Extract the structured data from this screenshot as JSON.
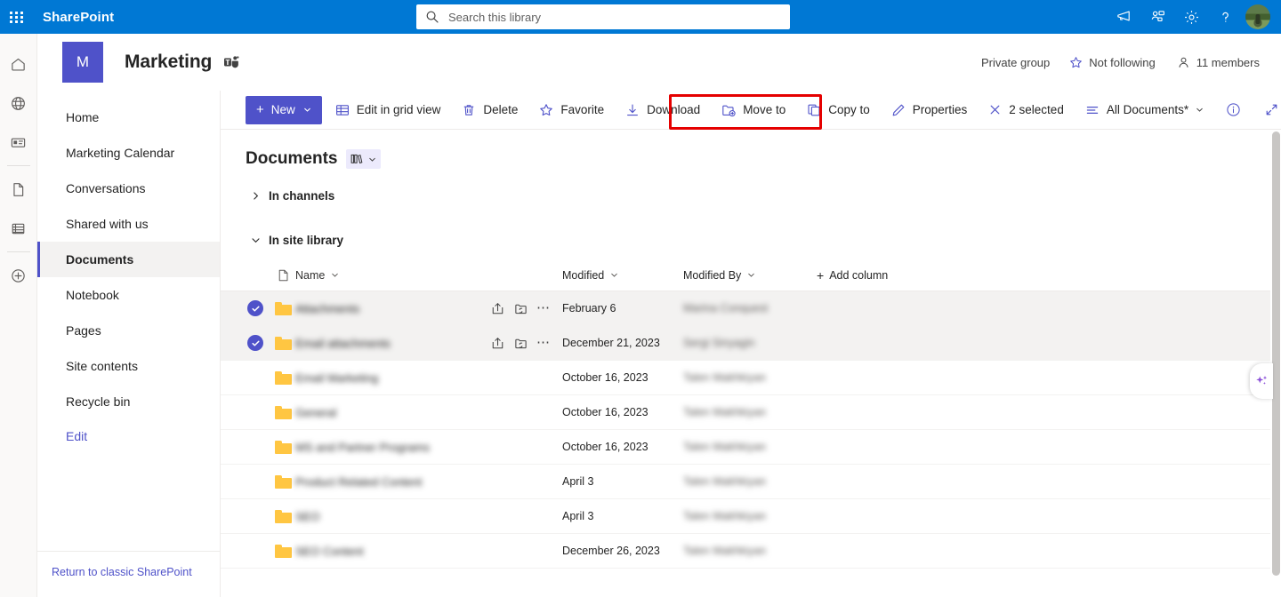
{
  "suite": {
    "waffle_label": "App launcher",
    "brand": "SharePoint",
    "search_placeholder": "Search this library",
    "search_value": "",
    "icons": [
      "megaphone-icon",
      "teams-chat-icon",
      "settings-gear-icon",
      "help-question-icon",
      "account-avatar"
    ]
  },
  "site": {
    "logo_letter": "M",
    "title": "Marketing",
    "teams_badge": "teams-icon",
    "privacy": "Private group",
    "follow_label": "Not following",
    "members_label": "11 members"
  },
  "rail": {
    "items": [
      {
        "name": "home-icon"
      },
      {
        "name": "globe-icon"
      },
      {
        "name": "news-icon"
      },
      {
        "name": "page-icon"
      },
      {
        "name": "lists-icon"
      },
      {
        "name": "create-icon"
      }
    ]
  },
  "leftnav": {
    "items": [
      {
        "label": "Home",
        "selected": false
      },
      {
        "label": "Marketing Calendar",
        "selected": false
      },
      {
        "label": "Conversations",
        "selected": false
      },
      {
        "label": "Shared with us",
        "selected": false
      },
      {
        "label": "Documents",
        "selected": true
      },
      {
        "label": "Notebook",
        "selected": false
      },
      {
        "label": "Pages",
        "selected": false
      },
      {
        "label": "Site contents",
        "selected": false
      },
      {
        "label": "Recycle bin",
        "selected": false
      }
    ],
    "edit_label": "Edit",
    "classic_link": "Return to classic SharePoint"
  },
  "commandbar": {
    "new_label": "New",
    "commands": [
      {
        "label": "Edit in grid view",
        "icon": "grid-view-icon"
      },
      {
        "label": "Delete",
        "icon": "trash-icon"
      },
      {
        "label": "Favorite",
        "icon": "star-icon"
      },
      {
        "label": "Download",
        "icon": "download-icon"
      },
      {
        "label": "Move to",
        "icon": "move-to-folder-icon"
      },
      {
        "label": "Copy to",
        "icon": "copy-to-icon"
      },
      {
        "label": "Properties",
        "icon": "pencil-icon"
      }
    ],
    "selected_count_label": "2 selected",
    "view_label": "All Documents*",
    "info_icon": "info-icon",
    "expand_icon": "expand-icon",
    "highlight": {
      "color": "#e50000",
      "targets": [
        "Move to",
        "Copy to"
      ]
    }
  },
  "library": {
    "title": "Documents",
    "view_switcher_icon": "library-view-icon",
    "groups": [
      {
        "label": "In channels",
        "expanded": false
      },
      {
        "label": "In site library",
        "expanded": true
      }
    ],
    "columns": {
      "type": "file-type-icon",
      "name": "Name",
      "modified": "Modified",
      "modified_by": "Modified By",
      "add_column": "Add column"
    },
    "rows": [
      {
        "name": "Attachments",
        "modified": "February 6",
        "modified_by": "Marina Conquest",
        "selected": true,
        "icon": "folder-icon",
        "blurred": true
      },
      {
        "name": "Email attachments",
        "modified": "December 21, 2023",
        "modified_by": "Sergi Sinyagin",
        "selected": true,
        "icon": "folder-icon",
        "blurred": true
      },
      {
        "name": "Email Marketing",
        "modified": "October 16, 2023",
        "modified_by": "Talen Makhkiyan",
        "selected": false,
        "icon": "folder-icon",
        "blurred": true
      },
      {
        "name": "General",
        "modified": "October 16, 2023",
        "modified_by": "Talen Makhkiyan",
        "selected": false,
        "icon": "folder-icon",
        "blurred": true
      },
      {
        "name": "MS and Partner Programs",
        "modified": "October 16, 2023",
        "modified_by": "Talen Makhkiyan",
        "selected": false,
        "icon": "folder-icon",
        "blurred": true
      },
      {
        "name": "Product Related Content",
        "modified": "April 3",
        "modified_by": "Talen Makhkiyan",
        "selected": false,
        "icon": "folder-icon",
        "blurred": true
      },
      {
        "name": "SEO",
        "modified": "April 3",
        "modified_by": "Talen Makhkiyan",
        "selected": false,
        "icon": "folder-icon",
        "blurred": true
      },
      {
        "name": "SEO Content",
        "modified": "December 26, 2023",
        "modified_by": "Talen Makhkiyan",
        "selected": false,
        "icon": "folder-icon",
        "blurred": true
      }
    ],
    "row_actions": [
      "share-icon",
      "copy-link-icon",
      "more-actions-icon"
    ]
  },
  "copilot": {
    "icon": "copilot-sparkle-icon"
  },
  "colors": {
    "suite_blue": "#0078d4",
    "accent_purple": "#4f52c9",
    "folder_yellow": "#ffc642",
    "highlight_red": "#e50000",
    "selected_row": "#f3f2f1"
  }
}
